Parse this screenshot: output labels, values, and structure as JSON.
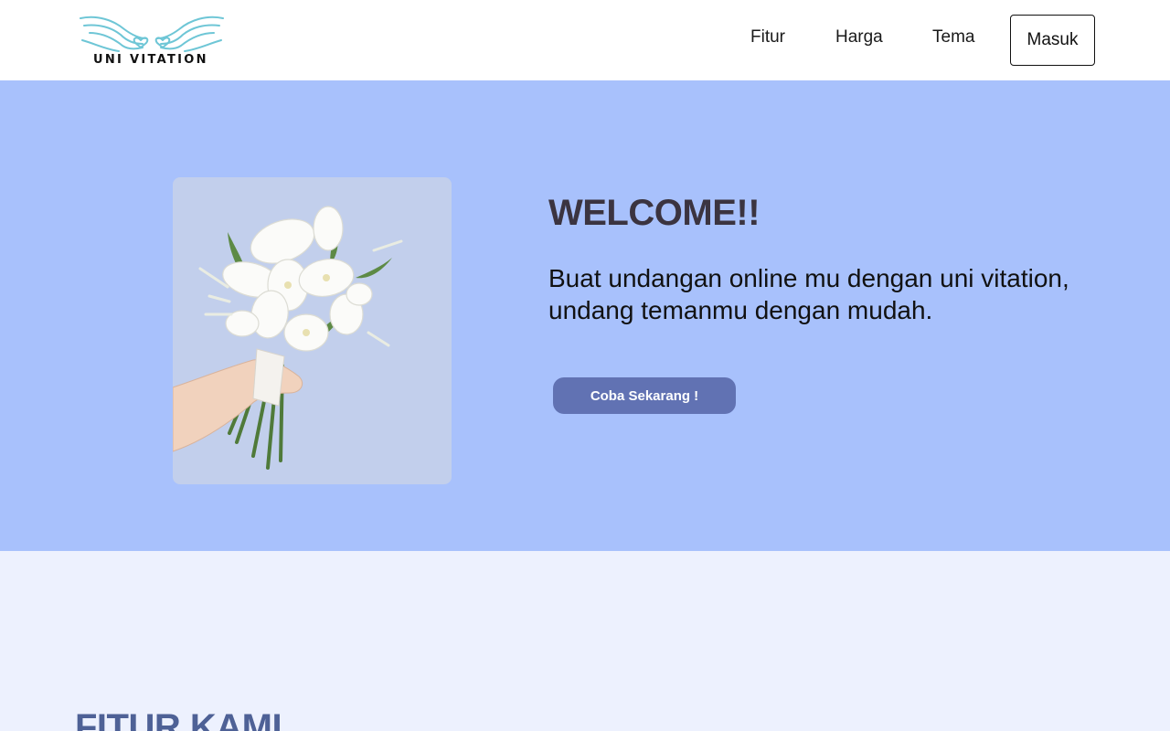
{
  "brand": {
    "name": "UNI VITATION",
    "logo_icon": "doves-heart-icon",
    "logo_color": "#6ec6d6"
  },
  "nav": {
    "items": [
      {
        "label": "Fitur"
      },
      {
        "label": "Harga"
      },
      {
        "label": "Tema"
      }
    ],
    "login_label": "Masuk"
  },
  "hero": {
    "background": "#a8c1fc",
    "image_icon": "bouquet-icon",
    "title": "WELCOME!!",
    "subtitle": "Buat undangan online mu dengan uni vitation, undang temanmu dengan mudah.",
    "cta_label": "Coba Sekarang !",
    "cta_color": "#6172b3"
  },
  "features": {
    "background": "#edf1fe",
    "title": "FITUR KAMI"
  }
}
